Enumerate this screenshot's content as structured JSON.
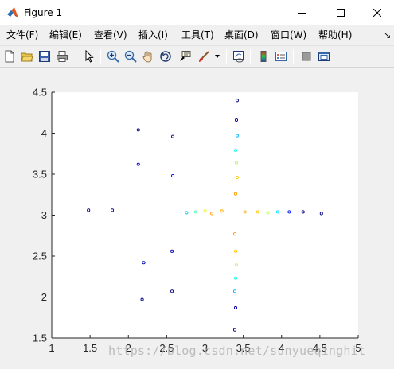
{
  "window": {
    "title": "Figure 1",
    "app_icon": "matlab-icon"
  },
  "menu": [
    {
      "label": "文件(F)"
    },
    {
      "label": "编辑(E)"
    },
    {
      "label": "查看(V)"
    },
    {
      "label": "插入(I)"
    },
    {
      "label": "工具(T)"
    },
    {
      "label": "桌面(D)"
    },
    {
      "label": "窗口(W)"
    },
    {
      "label": "帮助(H)"
    }
  ],
  "toolbar": [
    "new-figure-icon",
    "open-file-icon",
    "save-icon",
    "print-icon",
    "select-arrow-icon",
    "zoom-in-icon",
    "zoom-out-icon",
    "pan-hand-icon",
    "rotate-3d-icon",
    "data-cursor-icon",
    "brush-icon",
    "link-plot-icon",
    "colorbar-icon",
    "legend-icon",
    "hide-plot-tools-icon",
    "show-plot-tools-icon"
  ],
  "colors": {
    "plot_background": "#ffffff",
    "figure_background": "#f0f0f0"
  },
  "chart_data": {
    "type": "scatter",
    "marker": "o",
    "colormap": "jet",
    "xlim": [
      1,
      5
    ],
    "ylim": [
      1.5,
      4.5
    ],
    "xticks": [
      "1",
      "1.5",
      "2",
      "2.5",
      "3",
      "3.5",
      "4",
      "4.5",
      "5"
    ],
    "yticks": [
      "1.5",
      "2",
      "2.5",
      "3",
      "3.5",
      "4",
      "4.5"
    ],
    "grid": false,
    "points": [
      {
        "x": 3.42,
        "y": 4.4,
        "c": 0.0
      },
      {
        "x": 3.41,
        "y": 4.16,
        "c": 0.05
      },
      {
        "x": 3.42,
        "y": 3.97,
        "c": 0.3
      },
      {
        "x": 3.4,
        "y": 3.79,
        "c": 0.4
      },
      {
        "x": 3.41,
        "y": 3.64,
        "c": 0.55
      },
      {
        "x": 3.42,
        "y": 3.46,
        "c": 0.68
      },
      {
        "x": 3.4,
        "y": 3.26,
        "c": 0.72
      },
      {
        "x": 3.39,
        "y": 2.77,
        "c": 0.72
      },
      {
        "x": 3.4,
        "y": 2.56,
        "c": 0.68
      },
      {
        "x": 3.41,
        "y": 2.39,
        "c": 0.55
      },
      {
        "x": 3.4,
        "y": 2.23,
        "c": 0.4
      },
      {
        "x": 3.39,
        "y": 2.07,
        "c": 0.3
      },
      {
        "x": 3.4,
        "y": 1.87,
        "c": 0.05
      },
      {
        "x": 3.39,
        "y": 1.6,
        "c": 0.0
      },
      {
        "x": 1.48,
        "y": 3.06,
        "c": 0.0
      },
      {
        "x": 1.79,
        "y": 3.06,
        "c": 0.0
      },
      {
        "x": 2.76,
        "y": 3.03,
        "c": 0.32
      },
      {
        "x": 2.88,
        "y": 3.04,
        "c": 0.45
      },
      {
        "x": 3.0,
        "y": 3.05,
        "c": 0.6
      },
      {
        "x": 3.09,
        "y": 3.02,
        "c": 0.72
      },
      {
        "x": 3.22,
        "y": 3.05,
        "c": 0.7
      },
      {
        "x": 3.52,
        "y": 3.04,
        "c": 0.7
      },
      {
        "x": 3.69,
        "y": 3.04,
        "c": 0.68
      },
      {
        "x": 3.82,
        "y": 3.03,
        "c": 0.55
      },
      {
        "x": 3.95,
        "y": 3.04,
        "c": 0.35
      },
      {
        "x": 4.1,
        "y": 3.04,
        "c": 0.15
      },
      {
        "x": 4.28,
        "y": 3.04,
        "c": 0.02
      },
      {
        "x": 4.52,
        "y": 3.02,
        "c": 0.0
      },
      {
        "x": 2.13,
        "y": 4.04,
        "c": 0.0
      },
      {
        "x": 2.13,
        "y": 3.62,
        "c": 0.05
      },
      {
        "x": 2.58,
        "y": 3.96,
        "c": 0.0
      },
      {
        "x": 2.58,
        "y": 3.48,
        "c": 0.1
      },
      {
        "x": 2.2,
        "y": 2.42,
        "c": 0.05
      },
      {
        "x": 2.18,
        "y": 1.97,
        "c": 0.0
      },
      {
        "x": 2.57,
        "y": 2.56,
        "c": 0.05
      },
      {
        "x": 2.57,
        "y": 2.07,
        "c": 0.0
      }
    ]
  },
  "watermark": "https://blog.csdn.net/sunyueqinghit"
}
